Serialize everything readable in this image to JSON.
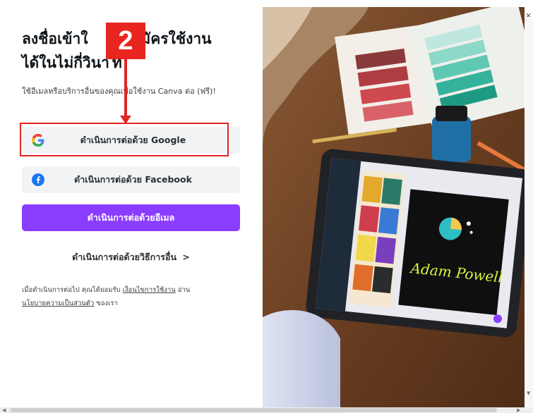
{
  "heading": "ลงชื่อเข้าใช้หรือสมัครใช้งานได้ในไม่กี่วินาที",
  "heading_visible": {
    "line1_a": "ลงชื่อเข้าใ",
    "line1_b": "สมัครใช้งาน",
    "line2_a": "ได้ในไม่กี่วินา",
    "line2_b": "ที"
  },
  "subtext": "ใช้อีเมลหรือบริการอื่นของคุณเพื่อใช้งาน Canva ต่อ (ฟรี)!",
  "buttons": {
    "google": "ดำเนินการต่อด้วย Google",
    "facebook": "ดำเนินการต่อด้วย Facebook",
    "email": "ดำเนินการต่อด้วยอีเมล"
  },
  "other_methods": "ดำเนินการต่อด้วยวิธีการอื่น",
  "terms": {
    "prefix": "เมื่อดำเนินการต่อไป คุณได้ยอมรับ ",
    "terms_link": "เงื่อนไขการใช้งาน",
    "mid": " อ่าน ",
    "privacy_link": "นโยบายความเป็นส่วนตัว",
    "suffix": " ของเรา"
  },
  "annotation": {
    "step_number": "2",
    "color": "#e02424"
  },
  "photo": {
    "tablet_text": "Adam Powell"
  },
  "colors": {
    "primary": "#8b3dff",
    "secondary_bg": "#f2f3f5",
    "facebook": "#1877f2",
    "annotation": "#e02424"
  },
  "icons": {
    "google": "google-g-icon",
    "facebook": "facebook-f-icon",
    "chevron": "chevron-right-icon",
    "close": "close-icon"
  }
}
